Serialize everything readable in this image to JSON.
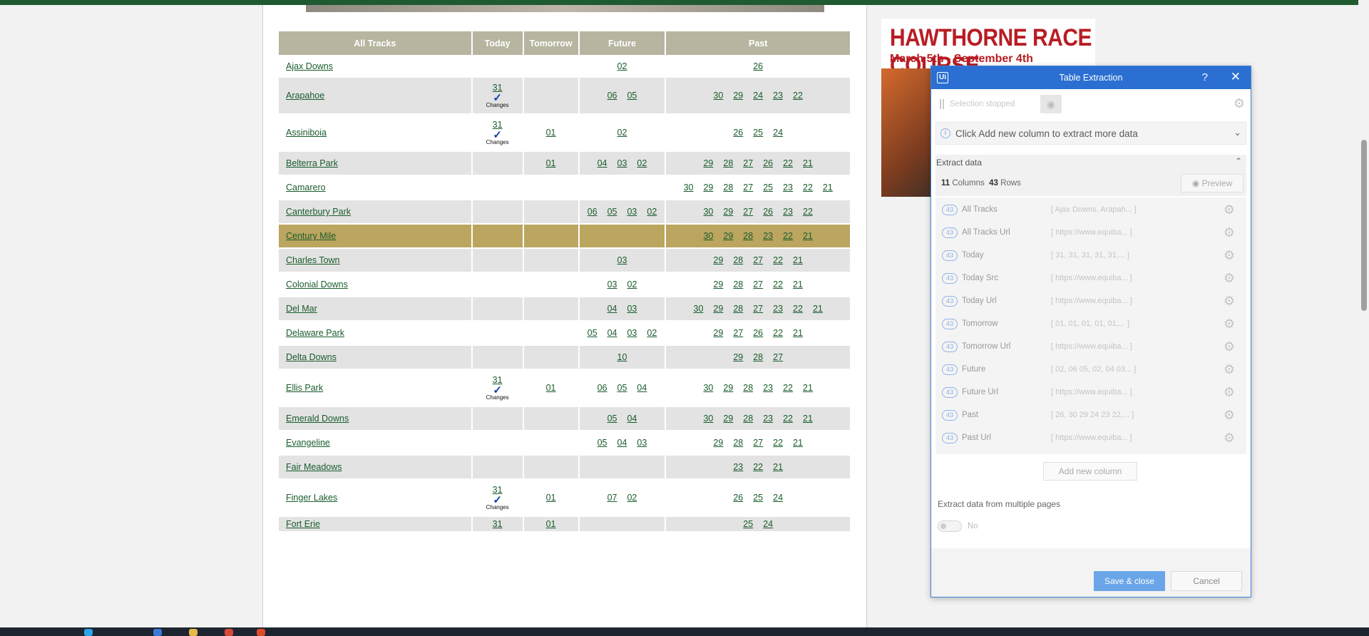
{
  "headers": {
    "all_tracks": "All Tracks",
    "today": "Today",
    "tomorrow": "Tomorrow",
    "future": "Future",
    "past": "Past"
  },
  "changes_label": "Changes",
  "rows": [
    {
      "name": "Ajax Downs",
      "today": "",
      "changes": false,
      "tomorrow": "",
      "future": [
        "02"
      ],
      "past": [
        "26"
      ]
    },
    {
      "name": "Arapahoe",
      "today": "31",
      "changes": true,
      "tomorrow": "",
      "future": [
        "06",
        "05"
      ],
      "past": [
        "30",
        "29",
        "24",
        "23",
        "22"
      ]
    },
    {
      "name": "Assiniboia",
      "today": "31",
      "changes": true,
      "tomorrow": "01",
      "future": [
        "02"
      ],
      "past": [
        "26",
        "25",
        "24"
      ]
    },
    {
      "name": "Belterra Park",
      "today": "",
      "changes": false,
      "tomorrow": "01",
      "future": [
        "04",
        "03",
        "02"
      ],
      "past": [
        "29",
        "28",
        "27",
        "26",
        "22",
        "21"
      ]
    },
    {
      "name": "Camarero",
      "today": "",
      "changes": false,
      "tomorrow": "",
      "future": [],
      "past": [
        "30",
        "29",
        "28",
        "27",
        "25",
        "23",
        "22",
        "21"
      ]
    },
    {
      "name": "Canterbury Park",
      "today": "",
      "changes": false,
      "tomorrow": "",
      "future": [
        "06",
        "05",
        "03",
        "02"
      ],
      "past": [
        "30",
        "29",
        "27",
        "26",
        "23",
        "22"
      ]
    },
    {
      "name": "Century Mile",
      "today": "",
      "changes": false,
      "tomorrow": "",
      "future": [],
      "past": [
        "30",
        "29",
        "28",
        "23",
        "22",
        "21"
      ],
      "highlight": true
    },
    {
      "name": "Charles Town",
      "today": "",
      "changes": false,
      "tomorrow": "",
      "future": [
        "03"
      ],
      "past": [
        "29",
        "28",
        "27",
        "22",
        "21"
      ]
    },
    {
      "name": "Colonial Downs",
      "today": "",
      "changes": false,
      "tomorrow": "",
      "future": [
        "03",
        "02"
      ],
      "past": [
        "29",
        "28",
        "27",
        "22",
        "21"
      ]
    },
    {
      "name": "Del Mar",
      "today": "",
      "changes": false,
      "tomorrow": "",
      "future": [
        "04",
        "03"
      ],
      "past": [
        "30",
        "29",
        "28",
        "27",
        "23",
        "22",
        "21"
      ]
    },
    {
      "name": "Delaware Park",
      "today": "",
      "changes": false,
      "tomorrow": "",
      "future": [
        "05",
        "04",
        "03",
        "02"
      ],
      "past": [
        "29",
        "27",
        "26",
        "22",
        "21"
      ]
    },
    {
      "name": "Delta Downs",
      "today": "",
      "changes": false,
      "tomorrow": "",
      "future": [
        "10"
      ],
      "past": [
        "29",
        "28",
        "27"
      ]
    },
    {
      "name": "Ellis Park",
      "today": "31",
      "changes": true,
      "tomorrow": "01",
      "future": [
        "06",
        "05",
        "04"
      ],
      "past": [
        "30",
        "29",
        "28",
        "23",
        "22",
        "21"
      ]
    },
    {
      "name": "Emerald Downs",
      "today": "",
      "changes": false,
      "tomorrow": "",
      "future": [
        "05",
        "04"
      ],
      "past": [
        "30",
        "29",
        "28",
        "23",
        "22",
        "21"
      ]
    },
    {
      "name": "Evangeline",
      "today": "",
      "changes": false,
      "tomorrow": "",
      "future": [
        "05",
        "04",
        "03"
      ],
      "past": [
        "29",
        "28",
        "27",
        "22",
        "21"
      ]
    },
    {
      "name": "Fair Meadows",
      "today": "",
      "changes": false,
      "tomorrow": "",
      "future": [],
      "past": [
        "23",
        "22",
        "21"
      ]
    },
    {
      "name": "Finger Lakes",
      "today": "31",
      "changes": true,
      "tomorrow": "01",
      "future": [
        "07",
        "02"
      ],
      "past": [
        "26",
        "25",
        "24"
      ]
    },
    {
      "name": "Fort Erie",
      "today": "31",
      "changes": false,
      "tomorrow": "01",
      "future": [],
      "past": [
        "25",
        "24"
      ]
    }
  ],
  "ad": {
    "title": "HAWTHORNE RACE COURSE",
    "subtitle": "March 5th - September 4th"
  },
  "dialog": {
    "title": "Table Extraction",
    "help": "?",
    "selection_status": "Selection stopped",
    "info": "Click Add new column to extract more data",
    "extract_header": "Extract data",
    "columns_count": "11",
    "columns_label": "Columns",
    "rows_count": "43",
    "rows_label": "Rows",
    "preview_label": "Preview",
    "columns": [
      {
        "count": "43",
        "name": "All Tracks",
        "preview": "[ Ajax Downs, Arapah... ]"
      },
      {
        "count": "43",
        "name": "All Tracks Url",
        "preview": "[ https://www.equiba... ]"
      },
      {
        "count": "43",
        "name": "Today",
        "preview": "[ 31, 31, 31, 31, 31,... ]"
      },
      {
        "count": "43",
        "name": "Today Src",
        "preview": "[ https://www.equiba... ]"
      },
      {
        "count": "43",
        "name": "Today Url",
        "preview": "[ https://www.equiba... ]"
      },
      {
        "count": "43",
        "name": "Tomorrow",
        "preview": "[ 01, 01, 01, 01, 01,... ]"
      },
      {
        "count": "43",
        "name": "Tomorrow Url",
        "preview": "[ https://www.equiba... ]"
      },
      {
        "count": "43",
        "name": "Future",
        "preview": "[ 02, 06 05, 02, 04 03... ]"
      },
      {
        "count": "43",
        "name": "Future Url",
        "preview": "[ https://www.equiba... ]"
      },
      {
        "count": "43",
        "name": "Past",
        "preview": "[ 26, 30 29 24 23 22,... ]"
      },
      {
        "count": "43",
        "name": "Past Url",
        "preview": "[ https://www.equiba... ]"
      }
    ],
    "add_column_label": "Add new column",
    "multi_page_label": "Extract data from multiple pages",
    "toggle_label": "No",
    "save_label": "Save & close",
    "cancel_label": "Cancel"
  }
}
